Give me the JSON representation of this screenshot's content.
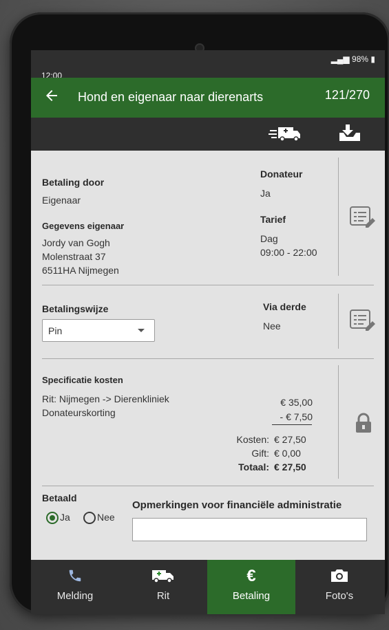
{
  "status": {
    "time": "12:00",
    "battery": "98%"
  },
  "header": {
    "title": "Hond en eigenaar naar dierenarts",
    "counter": "121/270"
  },
  "toolbar": {
    "icons": [
      "ambulance-icon",
      "download-tray-icon"
    ]
  },
  "payment": {
    "betaling_door_label": "Betaling door",
    "betaling_door_value": "Eigenaar",
    "gegevens_label": "Gegevens eigenaar",
    "owner_lines": [
      "Jordy van Gogh",
      "Molenstraat 37",
      "6511HA Nijmegen"
    ],
    "donateur_label": "Donateur",
    "donateur_value": "Ja",
    "tarief_label": "Tarief",
    "tarief_lines": [
      "Dag",
      "09:00  - 22:00"
    ]
  },
  "method": {
    "label": "Betalingswijze",
    "selected": "Pin",
    "via_derde_label": "Via derde",
    "via_derde_value": "Nee"
  },
  "costs": {
    "label": "Specificatie kosten",
    "lines": [
      {
        "desc": "Rit: Nijmegen  ->  Dierenkliniek",
        "amount": "€ 35,00"
      },
      {
        "desc": "Donateurskorting",
        "amount": "- €  7,50"
      }
    ],
    "kosten_label": "Kosten:",
    "kosten_value": "€  27,50",
    "gift_label": "Gift:",
    "gift_value": "€    0,00",
    "totaal_label": "Totaal:",
    "totaal_value": "€ 27,50"
  },
  "paid": {
    "label": "Betaald",
    "options": [
      "Ja",
      "Nee"
    ],
    "selected": "Ja",
    "remarks_label": "Opmerkingen voor financiële administratie",
    "remarks_value": ""
  },
  "nav": {
    "items": [
      {
        "label": "Melding",
        "icon": "phone-icon"
      },
      {
        "label": "Rit",
        "icon": "ambulance-icon"
      },
      {
        "label": "Betaling",
        "icon": "euro-icon"
      },
      {
        "label": "Foto's",
        "icon": "camera-icon"
      }
    ],
    "active": "Betaling"
  },
  "colors": {
    "brand_green": "#2c6b2a",
    "bar_dark": "#2f2f2f",
    "panel": "#e3e3e3"
  }
}
